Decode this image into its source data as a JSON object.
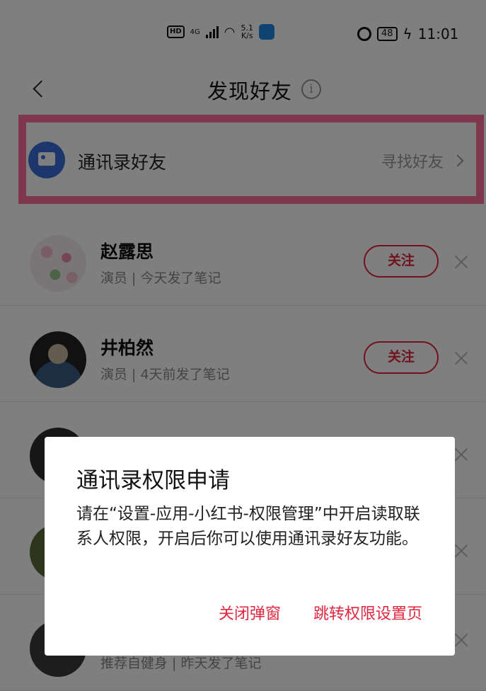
{
  "status_bar": {
    "hd": "HD",
    "network": "4G",
    "speed_value": "5.1",
    "speed_unit": "K/s",
    "battery": "48",
    "time": "11:01"
  },
  "header": {
    "title": "发现好友",
    "info_symbol": "i"
  },
  "contacts": {
    "label": "通讯录好友",
    "link": "寻找好友"
  },
  "list": {
    "follow_label": "关注",
    "items": [
      {
        "name": "赵露思",
        "desc": "演员 | 今天发了笔记"
      },
      {
        "name": "井柏然",
        "desc": "演员 | 4天前发了笔记"
      },
      {
        "name": "",
        "desc": ""
      },
      {
        "name": "",
        "desc": ""
      },
      {
        "name": "",
        "desc": "推荐自健身 | 昨天发了笔记"
      }
    ]
  },
  "dialog": {
    "title": "通讯录权限申请",
    "body": "请在“设置-应用-小红书-权限管理”中开启读取联系人权限，开启后你可以使用通讯录好友功能。",
    "close_label": "关闭弹窗",
    "confirm_label": "跳转权限设置页"
  },
  "colors": {
    "accent": "#e0263f",
    "highlight": "#ff6f9c",
    "contacts_icon": "#3b6fd8"
  },
  "icons": [
    "back-icon",
    "info-icon",
    "contacts-book-icon",
    "chevron-right-icon",
    "close-icon"
  ]
}
